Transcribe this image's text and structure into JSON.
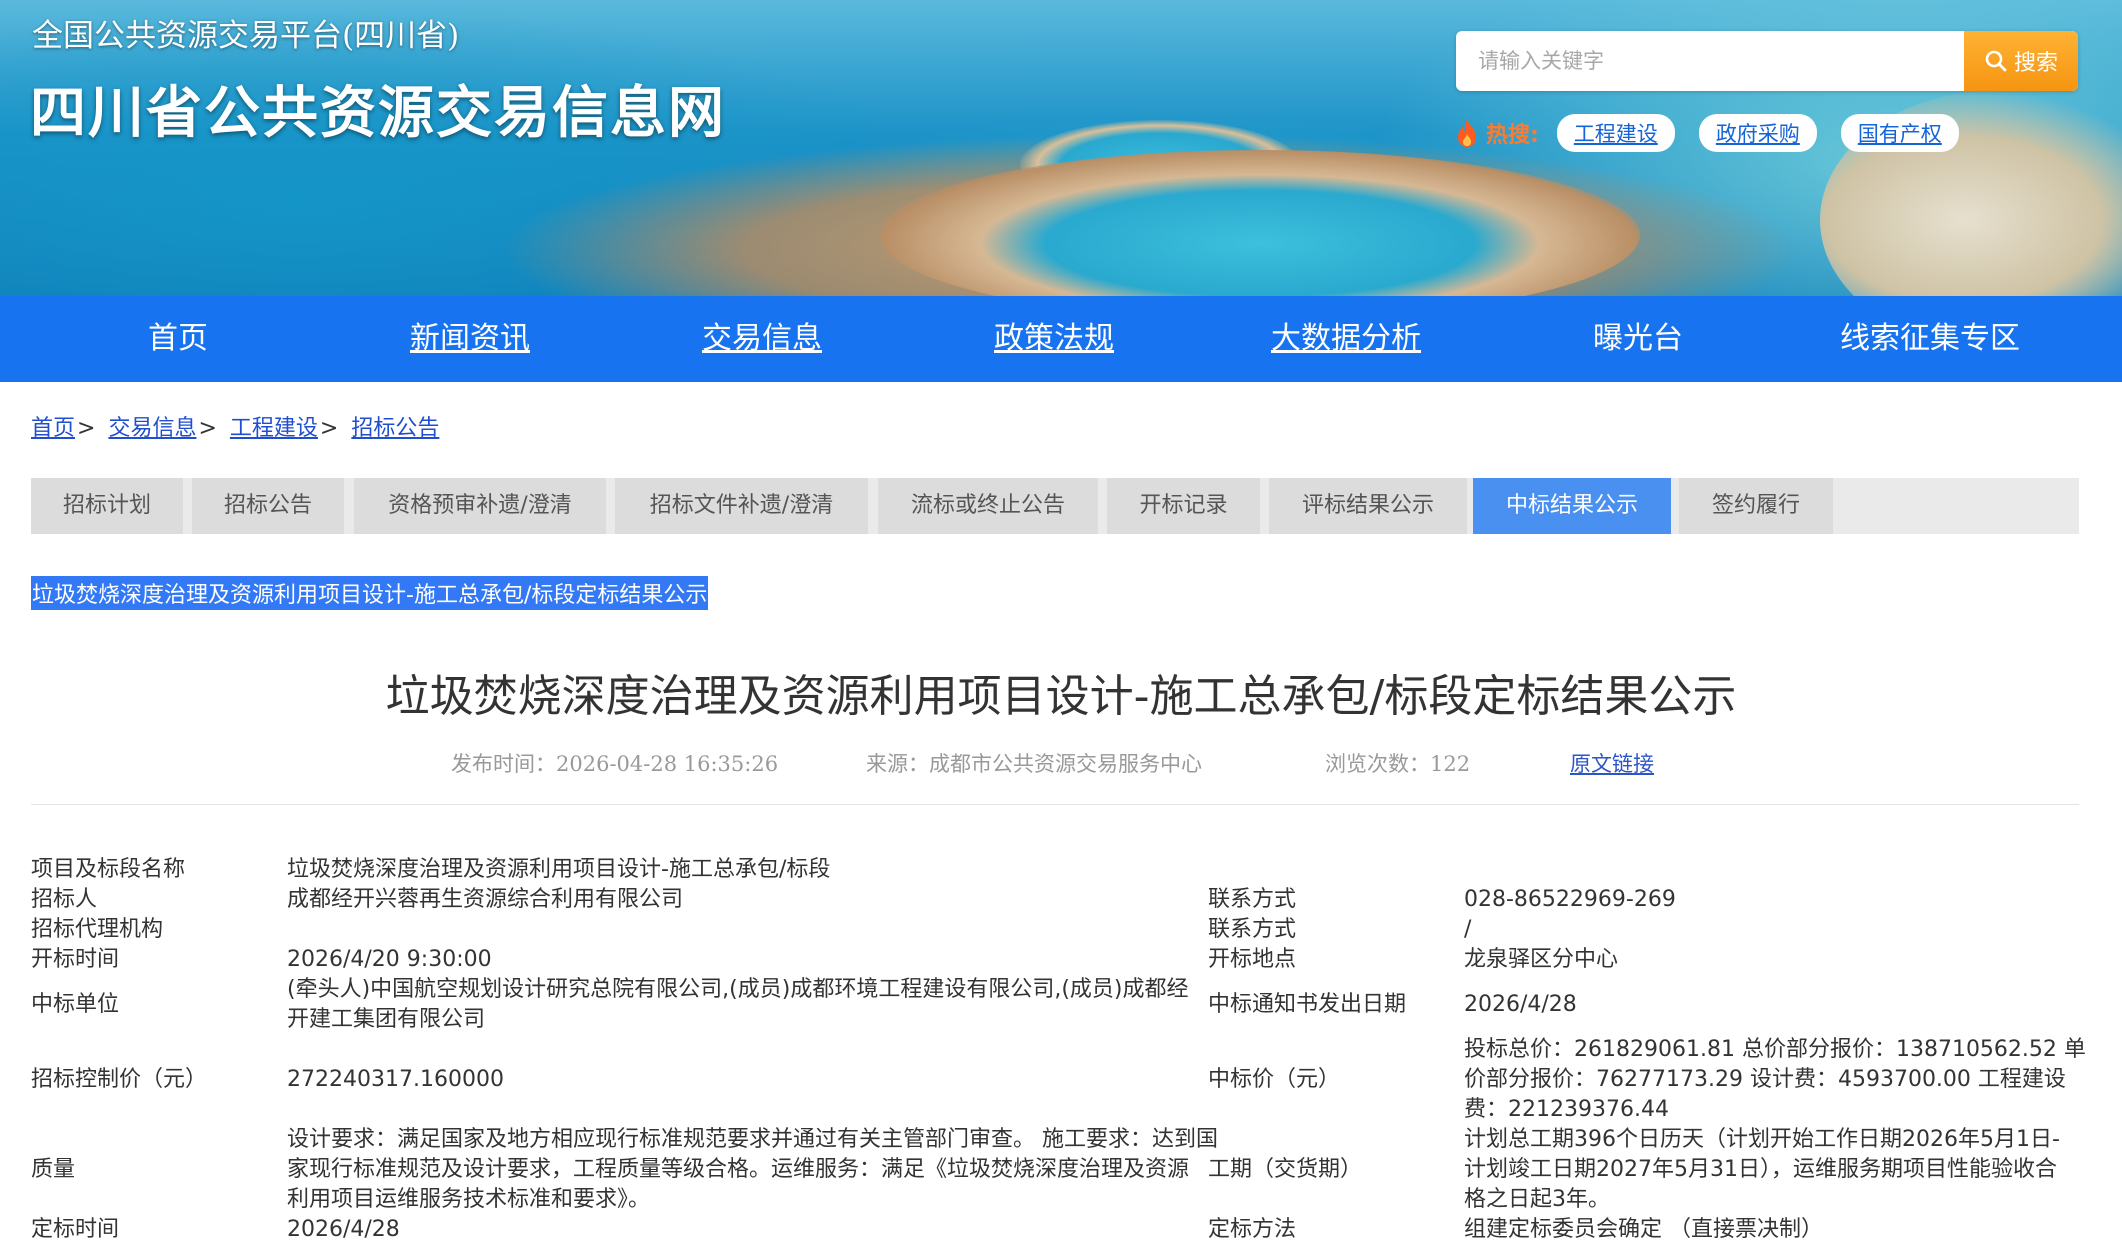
{
  "header": {
    "platform_name": "全国公共资源交易平台(四川省)",
    "site_title": "四川省公共资源交易信息网",
    "search": {
      "placeholder": "请输入关键字",
      "button_label": "搜索"
    },
    "hot_label": "热搜:",
    "hot_tags": [
      "工程建设",
      "政府采购",
      "国有产权"
    ]
  },
  "nav": [
    "首页",
    "新闻资讯",
    "交易信息",
    "政策法规",
    "大数据分析",
    "曝光台",
    "线索征集专区"
  ],
  "breadcrumb": [
    "首页",
    "交易信息",
    "工程建设",
    "招标公告"
  ],
  "breadcrumb_sep": ">",
  "tabs": [
    "招标计划",
    "招标公告",
    "资格预审补遗/澄清",
    "招标文件补遗/澄清",
    "流标或终止公告",
    "开标记录",
    "评标结果公示",
    "中标结果公示",
    "签约履行"
  ],
  "active_tab": "中标结果公示",
  "selected_item": "垃圾焚烧深度治理及资源利用项目设计-施工总承包/标段定标结果公示",
  "article": {
    "title": "垃圾焚烧深度治理及资源利用项目设计-施工总承包/标段定标结果公示",
    "publish_time": "发布时间：2026-04-28 16:35:26",
    "source": "来源：成都市公共资源交易服务中心",
    "views": "浏览次数：122",
    "original_link": "原文链接"
  },
  "info": {
    "project_name_label": "项目及标段名称",
    "project_name": "垃圾焚烧深度治理及资源利用项目设计-施工总承包/标段",
    "tenderer_label": "招标人",
    "tenderer": "成都经开兴蓉再生资源综合利用有限公司",
    "contact1_label": "联系方式",
    "contact1": "028-86522969-269",
    "agency_label": "招标代理机构",
    "agency": "",
    "contact2_label": "联系方式",
    "contact2": "/",
    "open_time_label": "开标时间",
    "open_time": "2026/4/20 9:30:00",
    "open_place_label": "开标地点",
    "open_place": "龙泉驿区分中心",
    "winner_label": "中标单位",
    "winner_line1": "(牵头人)中国航空规划设计研究总院有限公司,(成员)成都环境工程建设有限公司,(成员)成都经",
    "winner_line2": "开建工集团有限公司",
    "notice_date_label": "中标通知书发出日期",
    "notice_date": "2026/4/28",
    "control_price_label": "招标控制价（元）",
    "control_price": "272240317.160000",
    "bid_price_label": "中标价（元）",
    "bid_price_line1": "投标总价：261829061.81 总价部分报价：138710562.52 单",
    "bid_price_line2": "价部分报价：76277173.29 设计费：4593700.00 工程建设",
    "bid_price_line3": "费：221239376.44",
    "quality_label": "质量",
    "quality_line1": "设计要求：满足国家及地方相应现行标准规范要求并通过有关主管部门审查。 施工要求：达到国",
    "quality_line2": "家现行标准规范及设计要求，工程质量等级合格。运维服务：满足《垃圾焚烧深度治理及资源",
    "quality_line3": "利用项目运维服务技术标准和要求》。",
    "duration_label": "工期（交货期）",
    "duration_line1": "计划总工期396个日历天（计划开始工作日期2026年5月1日-",
    "duration_line2": "计划竣工日期2027年5月31日），运维服务期项目性能验收合",
    "duration_line3": "格之日起3年。",
    "award_time_label": "定标时间",
    "award_time": "2026/4/28",
    "award_method_label": "定标方法",
    "award_method": "组建定标委员会确定 （直接票决制）"
  },
  "colors": {
    "nav_bg": "#1773f0",
    "active_tab": "#4a90f0",
    "search_button": "#f59512",
    "hot_label": "#ff7a2f",
    "link": "#1f4fd0"
  }
}
